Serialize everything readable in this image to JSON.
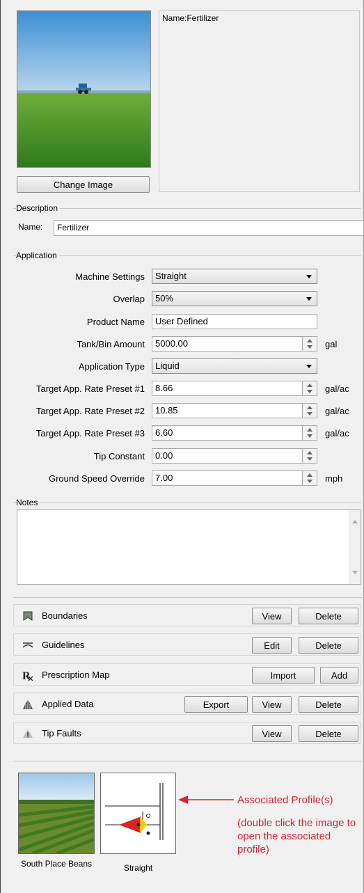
{
  "top": {
    "name_display": "Name:Fertilizer",
    "change_image_label": "Change Image"
  },
  "description": {
    "title": "Description",
    "name_label": "Name:",
    "name_value": "Fertilizer"
  },
  "application": {
    "title": "Application",
    "machine_settings": {
      "label": "Machine Settings",
      "value": "Straight"
    },
    "overlap": {
      "label": "Overlap",
      "value": "50%"
    },
    "product_name": {
      "label": "Product Name",
      "value": "User Defined"
    },
    "tank_bin_amount": {
      "label": "Tank/Bin Amount",
      "value": "5000.00",
      "unit": "gal"
    },
    "application_type": {
      "label": "Application Type",
      "value": "Liquid"
    },
    "preset1": {
      "label": "Target App. Rate Preset #1",
      "value": "8.66",
      "unit": "gal/ac"
    },
    "preset2": {
      "label": "Target App. Rate Preset #2",
      "value": "10.85",
      "unit": "gal/ac"
    },
    "preset3": {
      "label": "Target App. Rate Preset #3",
      "value": "6.60",
      "unit": "gal/ac"
    },
    "tip_constant": {
      "label": "Tip Constant",
      "value": "0.00"
    },
    "ground_speed": {
      "label": "Ground Speed Override",
      "value": "7.00",
      "unit": "mph"
    }
  },
  "notes": {
    "title": "Notes",
    "value": ""
  },
  "data_rows": {
    "boundaries": {
      "label": "Boundaries",
      "icon": "boundary-icon",
      "view": "View",
      "delete": "Delete"
    },
    "guidelines": {
      "label": "Guidelines",
      "icon": "guideline-icon",
      "edit": "Edit",
      "delete": "Delete"
    },
    "prescription": {
      "label": "Prescription Map",
      "icon": "prescription-icon",
      "import": "Import",
      "add": "Add"
    },
    "applied": {
      "label": "Applied Data",
      "icon": "applied-data-icon",
      "export": "Export",
      "view": "View",
      "delete": "Delete"
    },
    "tipfaults": {
      "label": "Tip Faults",
      "icon": "warning-icon",
      "view": "View",
      "delete": "Delete"
    }
  },
  "profiles": {
    "items": [
      {
        "caption": "South Place Beans"
      },
      {
        "caption": "Straight"
      }
    ],
    "annotation_title": "Associated Profile(s)",
    "annotation_note": "(double click the image to open the associated profile)"
  },
  "colors": {
    "annotation": "#d9232f",
    "window_bg": "#f0f0f0",
    "field_bg": "#ffffff"
  }
}
